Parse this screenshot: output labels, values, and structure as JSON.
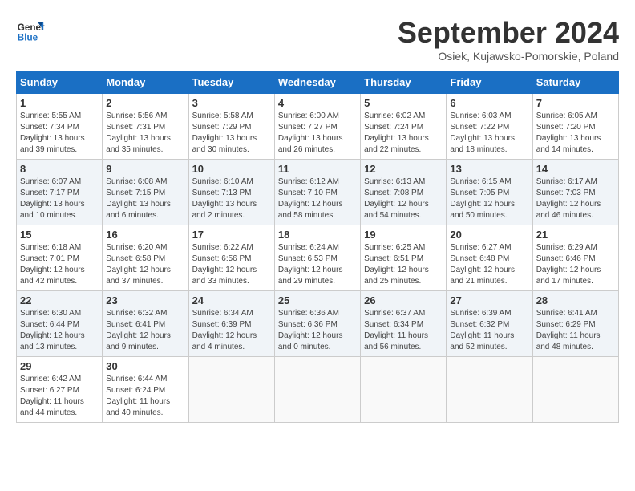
{
  "header": {
    "logo_line1": "General",
    "logo_line2": "Blue",
    "month": "September 2024",
    "location": "Osiek, Kujawsko-Pomorskie, Poland"
  },
  "days_of_week": [
    "Sunday",
    "Monday",
    "Tuesday",
    "Wednesday",
    "Thursday",
    "Friday",
    "Saturday"
  ],
  "weeks": [
    [
      {
        "day": "1",
        "info": "Sunrise: 5:55 AM\nSunset: 7:34 PM\nDaylight: 13 hours\nand 39 minutes."
      },
      {
        "day": "2",
        "info": "Sunrise: 5:56 AM\nSunset: 7:31 PM\nDaylight: 13 hours\nand 35 minutes."
      },
      {
        "day": "3",
        "info": "Sunrise: 5:58 AM\nSunset: 7:29 PM\nDaylight: 13 hours\nand 30 minutes."
      },
      {
        "day": "4",
        "info": "Sunrise: 6:00 AM\nSunset: 7:27 PM\nDaylight: 13 hours\nand 26 minutes."
      },
      {
        "day": "5",
        "info": "Sunrise: 6:02 AM\nSunset: 7:24 PM\nDaylight: 13 hours\nand 22 minutes."
      },
      {
        "day": "6",
        "info": "Sunrise: 6:03 AM\nSunset: 7:22 PM\nDaylight: 13 hours\nand 18 minutes."
      },
      {
        "day": "7",
        "info": "Sunrise: 6:05 AM\nSunset: 7:20 PM\nDaylight: 13 hours\nand 14 minutes."
      }
    ],
    [
      {
        "day": "8",
        "info": "Sunrise: 6:07 AM\nSunset: 7:17 PM\nDaylight: 13 hours\nand 10 minutes."
      },
      {
        "day": "9",
        "info": "Sunrise: 6:08 AM\nSunset: 7:15 PM\nDaylight: 13 hours\nand 6 minutes."
      },
      {
        "day": "10",
        "info": "Sunrise: 6:10 AM\nSunset: 7:13 PM\nDaylight: 13 hours\nand 2 minutes."
      },
      {
        "day": "11",
        "info": "Sunrise: 6:12 AM\nSunset: 7:10 PM\nDaylight: 12 hours\nand 58 minutes."
      },
      {
        "day": "12",
        "info": "Sunrise: 6:13 AM\nSunset: 7:08 PM\nDaylight: 12 hours\nand 54 minutes."
      },
      {
        "day": "13",
        "info": "Sunrise: 6:15 AM\nSunset: 7:05 PM\nDaylight: 12 hours\nand 50 minutes."
      },
      {
        "day": "14",
        "info": "Sunrise: 6:17 AM\nSunset: 7:03 PM\nDaylight: 12 hours\nand 46 minutes."
      }
    ],
    [
      {
        "day": "15",
        "info": "Sunrise: 6:18 AM\nSunset: 7:01 PM\nDaylight: 12 hours\nand 42 minutes."
      },
      {
        "day": "16",
        "info": "Sunrise: 6:20 AM\nSunset: 6:58 PM\nDaylight: 12 hours\nand 37 minutes."
      },
      {
        "day": "17",
        "info": "Sunrise: 6:22 AM\nSunset: 6:56 PM\nDaylight: 12 hours\nand 33 minutes."
      },
      {
        "day": "18",
        "info": "Sunrise: 6:24 AM\nSunset: 6:53 PM\nDaylight: 12 hours\nand 29 minutes."
      },
      {
        "day": "19",
        "info": "Sunrise: 6:25 AM\nSunset: 6:51 PM\nDaylight: 12 hours\nand 25 minutes."
      },
      {
        "day": "20",
        "info": "Sunrise: 6:27 AM\nSunset: 6:48 PM\nDaylight: 12 hours\nand 21 minutes."
      },
      {
        "day": "21",
        "info": "Sunrise: 6:29 AM\nSunset: 6:46 PM\nDaylight: 12 hours\nand 17 minutes."
      }
    ],
    [
      {
        "day": "22",
        "info": "Sunrise: 6:30 AM\nSunset: 6:44 PM\nDaylight: 12 hours\nand 13 minutes."
      },
      {
        "day": "23",
        "info": "Sunrise: 6:32 AM\nSunset: 6:41 PM\nDaylight: 12 hours\nand 9 minutes."
      },
      {
        "day": "24",
        "info": "Sunrise: 6:34 AM\nSunset: 6:39 PM\nDaylight: 12 hours\nand 4 minutes."
      },
      {
        "day": "25",
        "info": "Sunrise: 6:36 AM\nSunset: 6:36 PM\nDaylight: 12 hours\nand 0 minutes."
      },
      {
        "day": "26",
        "info": "Sunrise: 6:37 AM\nSunset: 6:34 PM\nDaylight: 11 hours\nand 56 minutes."
      },
      {
        "day": "27",
        "info": "Sunrise: 6:39 AM\nSunset: 6:32 PM\nDaylight: 11 hours\nand 52 minutes."
      },
      {
        "day": "28",
        "info": "Sunrise: 6:41 AM\nSunset: 6:29 PM\nDaylight: 11 hours\nand 48 minutes."
      }
    ],
    [
      {
        "day": "29",
        "info": "Sunrise: 6:42 AM\nSunset: 6:27 PM\nDaylight: 11 hours\nand 44 minutes."
      },
      {
        "day": "30",
        "info": "Sunrise: 6:44 AM\nSunset: 6:24 PM\nDaylight: 11 hours\nand 40 minutes."
      },
      {
        "day": "",
        "info": ""
      },
      {
        "day": "",
        "info": ""
      },
      {
        "day": "",
        "info": ""
      },
      {
        "day": "",
        "info": ""
      },
      {
        "day": "",
        "info": ""
      }
    ]
  ]
}
